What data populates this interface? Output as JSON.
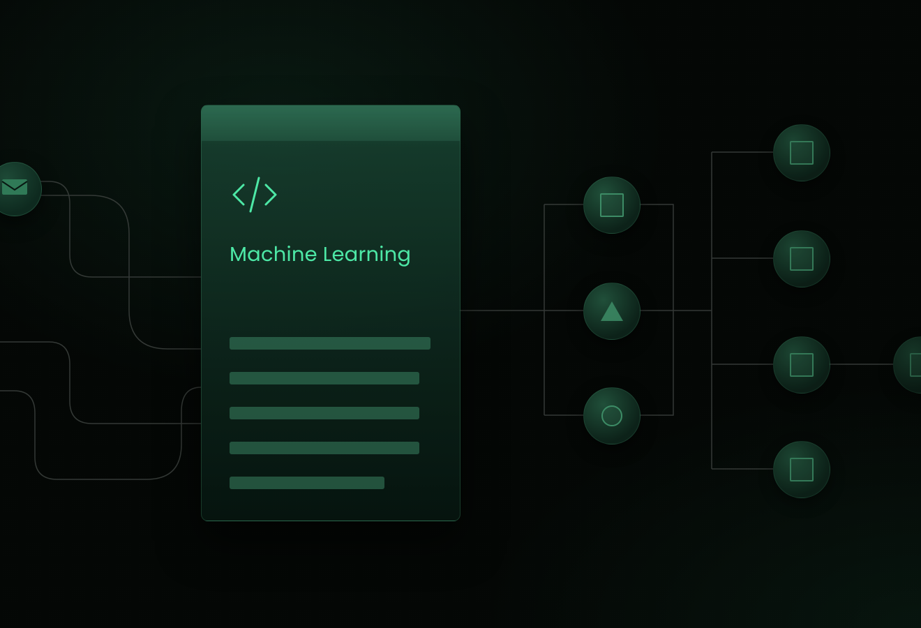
{
  "card": {
    "title": "Machine Learning",
    "icon": "code-icon"
  },
  "input": {
    "icon": "envelope-icon"
  },
  "layers": {
    "mid": [
      {
        "shape": "square"
      },
      {
        "shape": "triangle"
      },
      {
        "shape": "circle"
      }
    ],
    "right": [
      {
        "shape": "square"
      },
      {
        "shape": "square"
      },
      {
        "shape": "square"
      },
      {
        "shape": "square"
      }
    ],
    "far": [
      {
        "shape": "square"
      }
    ]
  },
  "colors": {
    "accent": "#4de8a6",
    "node_border": "#3d8c66",
    "wire": "#3a3f3c"
  }
}
